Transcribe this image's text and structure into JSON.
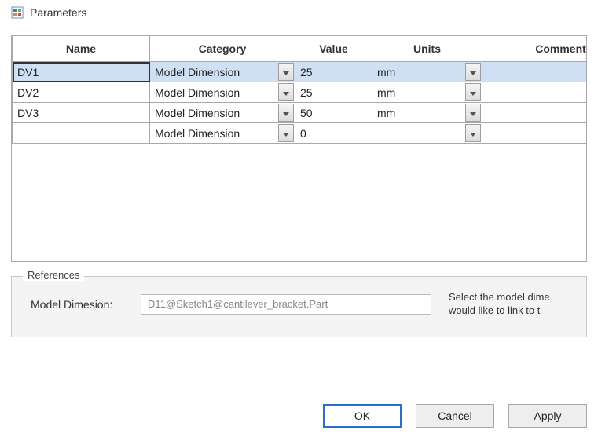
{
  "window": {
    "title": "Parameters"
  },
  "table": {
    "headers": {
      "name": "Name",
      "category": "Category",
      "value": "Value",
      "units": "Units",
      "comment": "Comment"
    },
    "rows": [
      {
        "name": "DV1",
        "category": "Model Dimension",
        "value": "25",
        "units": "mm",
        "comment": "",
        "selected": true
      },
      {
        "name": "DV2",
        "category": "Model Dimension",
        "value": "25",
        "units": "mm",
        "comment": "",
        "selected": false
      },
      {
        "name": "DV3",
        "category": "Model Dimension",
        "value": "50",
        "units": "mm",
        "comment": "",
        "selected": false
      },
      {
        "name": "",
        "category": "Model Dimension",
        "value": "0",
        "units": "",
        "comment": "",
        "selected": false
      }
    ]
  },
  "references": {
    "legend": "References",
    "label": "Model Dimesion:",
    "value": "D11@Sketch1@cantilever_bracket.Part",
    "help": "Select the model dime\nwould like to link to t"
  },
  "buttons": {
    "ok": "OK",
    "cancel": "Cancel",
    "apply": "Apply"
  }
}
